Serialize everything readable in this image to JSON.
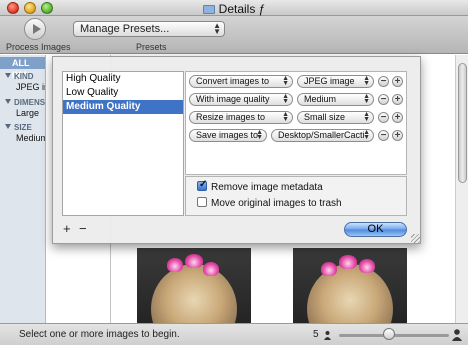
{
  "window": {
    "title": "Details ƒ"
  },
  "toolbar": {
    "process_label": "Process Images",
    "presets_popup_value": "Manage Presets...",
    "presets_label": "Presets"
  },
  "sidebar": {
    "all": "ALL IMA",
    "sections": [
      {
        "head": "KIND",
        "value": "JPEG ima"
      },
      {
        "head": "DIMENS",
        "value": "Large"
      },
      {
        "head": "SIZE",
        "value": "Medium"
      }
    ]
  },
  "sheet": {
    "presets": [
      "High Quality",
      "Low Quality",
      "Medium Quality"
    ],
    "selected_preset": "Medium Quality",
    "add_label": "+",
    "remove_label": "−",
    "actions": [
      {
        "action": "Convert images to",
        "value": "JPEG image"
      },
      {
        "action": "With image quality",
        "value": "Medium"
      },
      {
        "action": "Resize images to",
        "value": "Small size"
      },
      {
        "action": "Save images to",
        "value": "Desktop/SmallerCacti"
      }
    ],
    "row_minus": "−",
    "row_plus": "+",
    "options": [
      {
        "label": "Remove image metadata",
        "checked": true
      },
      {
        "label": "Move original images to trash",
        "checked": false
      }
    ],
    "ok_label": "OK"
  },
  "status": {
    "text": "Select one or more images to begin.",
    "size_value": "5",
    "slider_fraction": 0.45
  },
  "colors": {
    "selection_blue": "#3f73c5",
    "ok_button": "#6fa6ec",
    "flower_pink": "#e24aa6"
  }
}
